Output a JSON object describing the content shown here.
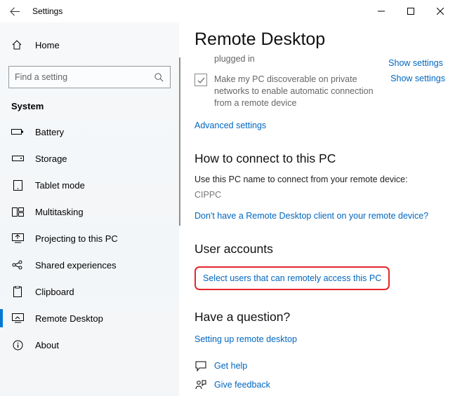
{
  "window": {
    "title": "Settings"
  },
  "sidebar": {
    "home_label": "Home",
    "search_placeholder": "Find a setting",
    "category": "System",
    "items": [
      {
        "label": "Battery"
      },
      {
        "label": "Storage"
      },
      {
        "label": "Tablet mode"
      },
      {
        "label": "Multitasking"
      },
      {
        "label": "Projecting to this PC"
      },
      {
        "label": "Shared experiences"
      },
      {
        "label": "Clipboard"
      },
      {
        "label": "Remote Desktop"
      },
      {
        "label": "About"
      }
    ]
  },
  "content": {
    "page_title": "Remote Desktop",
    "truncated_top": "plugged in",
    "show_settings_top": "Show settings",
    "discoverable_desc": "Make my PC discoverable on private networks to enable automatic connection from a remote device",
    "show_settings_side": "Show settings",
    "advanced_settings": "Advanced settings",
    "connect_heading": "How to connect to this PC",
    "connect_desc": "Use this PC name to connect from your remote device:",
    "pc_name": "CIPPC",
    "client_link": "Don't have a Remote Desktop client on your remote device?",
    "user_accounts_heading": "User accounts",
    "select_users_link": "Select users that can remotely access this PC",
    "question_heading": "Have a question?",
    "setup_link": "Setting up remote desktop",
    "get_help": "Get help",
    "give_feedback": "Give feedback"
  }
}
